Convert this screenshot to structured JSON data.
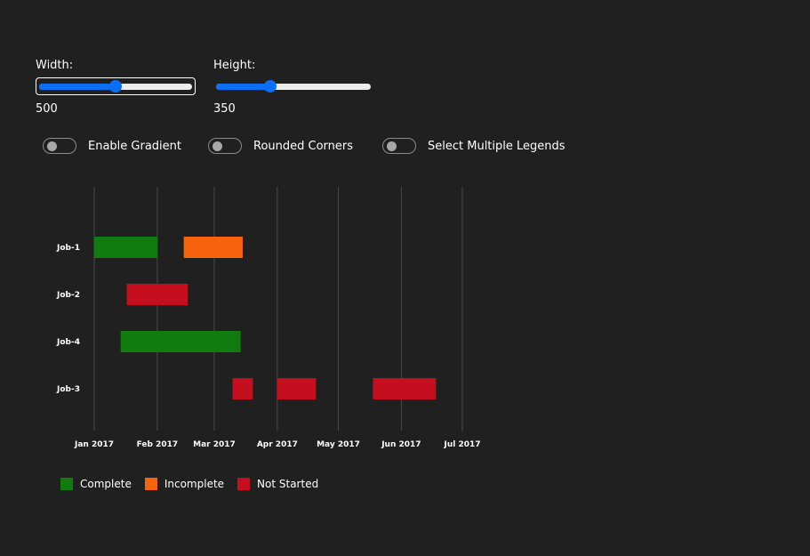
{
  "controls": {
    "width": {
      "label": "Width:",
      "value": "500",
      "fraction": 0.5
    },
    "height": {
      "label": "Height:",
      "value": "350",
      "fraction": 0.35
    },
    "toggles": [
      {
        "label": "Enable Gradient",
        "on": false
      },
      {
        "label": "Rounded Corners",
        "on": false
      },
      {
        "label": "Select Multiple Legends",
        "on": false
      }
    ]
  },
  "chart_data": {
    "type": "gantt",
    "x_ticks": [
      "Jan 2017",
      "Feb 2017",
      "Mar 2017",
      "Apr 2017",
      "May 2017",
      "Jun 2017",
      "Jul 2017"
    ],
    "xlim": [
      "2017-01-01",
      "2017-07-01"
    ],
    "grid": true,
    "categories": [
      "Job-1",
      "Job-2",
      "Job-4",
      "Job-3"
    ],
    "tasks": [
      {
        "job": "Job-1",
        "start": "2017-01-01",
        "end": "2017-02-01",
        "status": "Complete"
      },
      {
        "job": "Job-1",
        "start": "2017-02-14",
        "end": "2017-03-15",
        "status": "Incomplete"
      },
      {
        "job": "Job-2",
        "start": "2017-01-17",
        "end": "2017-02-16",
        "status": "Not Started"
      },
      {
        "job": "Job-4",
        "start": "2017-01-14",
        "end": "2017-03-14",
        "status": "Complete"
      },
      {
        "job": "Job-3",
        "start": "2017-03-10",
        "end": "2017-03-20",
        "status": "Not Started"
      },
      {
        "job": "Job-3",
        "start": "2017-04-01",
        "end": "2017-04-20",
        "status": "Not Started"
      },
      {
        "job": "Job-3",
        "start": "2017-05-18",
        "end": "2017-06-18",
        "status": "Not Started"
      }
    ],
    "legend": [
      {
        "name": "Complete",
        "color": "#107c10"
      },
      {
        "name": "Incomplete",
        "color": "#f7630c"
      },
      {
        "name": "Not Started",
        "color": "#c50f1f"
      }
    ],
    "legend_position": "bottom-left"
  }
}
